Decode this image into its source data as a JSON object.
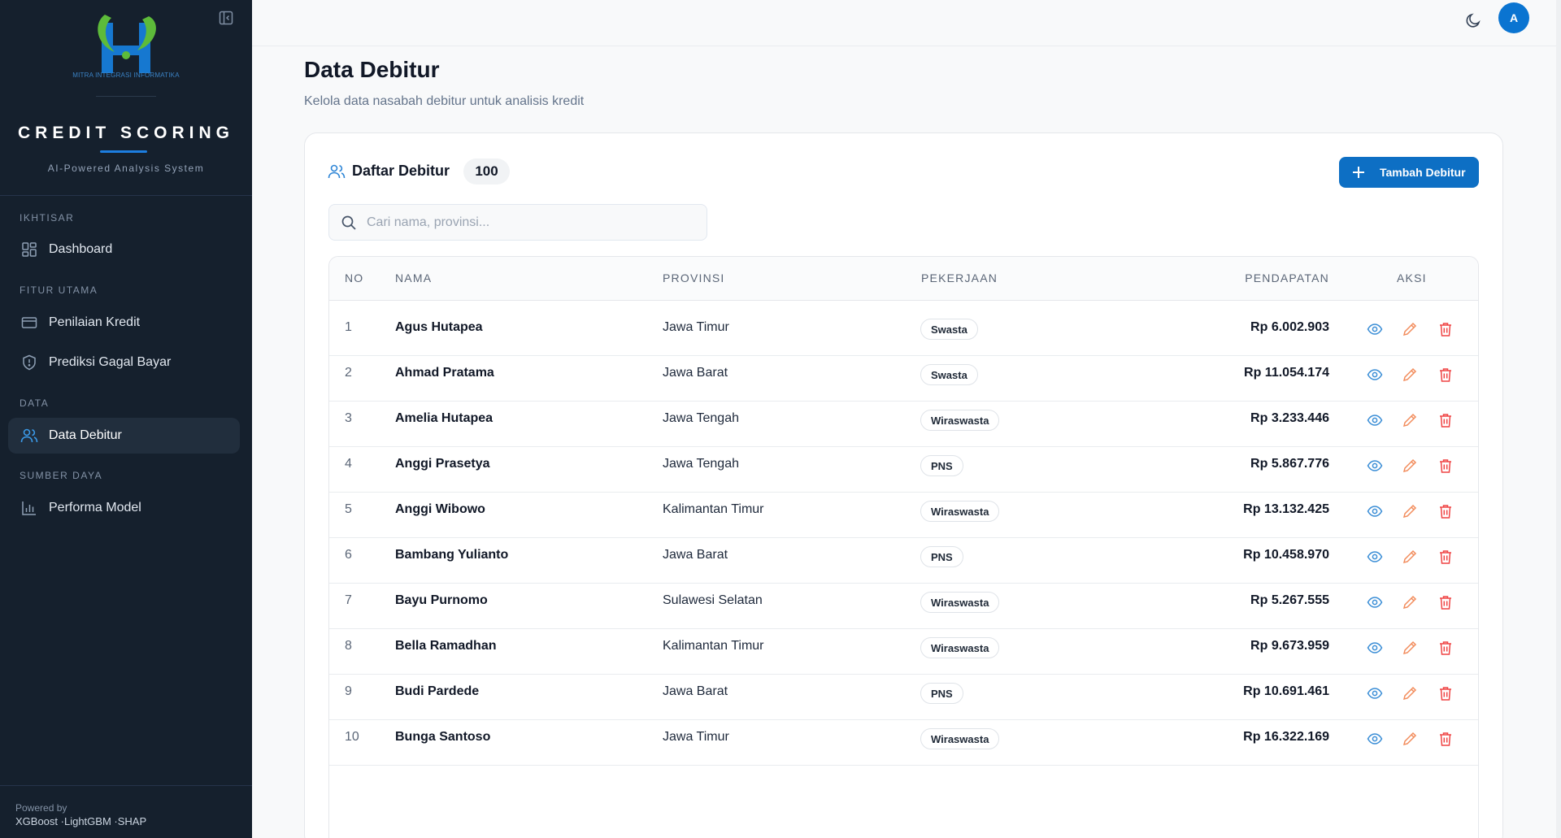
{
  "colors": {
    "sidebar_bg": "#15202d",
    "accent": "#0d6fc4",
    "edit": "#f28c5c",
    "delete": "#ef4444",
    "view": "#3b8ed6"
  },
  "sidebar": {
    "logo_tagline": "MITRA INTEGRASI INFORMATIKA",
    "brand_title": "CREDIT SCORING",
    "brand_subtitle": "AI-Powered Analysis System",
    "sections": [
      {
        "label": "IKHTISAR",
        "items": [
          {
            "label": "Dashboard",
            "icon": "dashboard-grid-icon"
          }
        ]
      },
      {
        "label": "FITUR UTAMA",
        "items": [
          {
            "label": "Penilaian Kredit",
            "icon": "credit-card-icon"
          },
          {
            "label": "Prediksi Gagal Bayar",
            "icon": "shield-icon"
          }
        ]
      },
      {
        "label": "DATA",
        "items": [
          {
            "label": "Data Debitur",
            "icon": "users-icon",
            "active": true
          }
        ]
      },
      {
        "label": "SUMBER DAYA",
        "items": [
          {
            "label": "Performa Model",
            "icon": "bar-chart-icon"
          }
        ]
      }
    ],
    "footer_powered": "Powered by",
    "footer_stack": "XGBoost ·LightGBM ·SHAP"
  },
  "topbar": {
    "avatar_initial": "A"
  },
  "page": {
    "title": "Data Debitur",
    "subtitle": "Kelola data nasabah debitur untuk analisis kredit"
  },
  "card": {
    "title": "Daftar Debitur",
    "count": "100",
    "add_button": "Tambah Debitur",
    "search_placeholder": "Cari nama, provinsi..."
  },
  "table": {
    "headers": {
      "no": "NO",
      "nama": "NAMA",
      "provinsi": "PROVINSI",
      "pekerjaan": "PEKERJAAN",
      "pendapatan": "PENDAPATAN",
      "aksi": "AKSI"
    },
    "rows": [
      {
        "no": "1",
        "nama": "Agus Hutapea",
        "provinsi": "Jawa Timur",
        "pekerjaan": "Swasta",
        "pendapatan": "Rp 6.002.903"
      },
      {
        "no": "2",
        "nama": "Ahmad Pratama",
        "provinsi": "Jawa Barat",
        "pekerjaan": "Swasta",
        "pendapatan": "Rp 11.054.174"
      },
      {
        "no": "3",
        "nama": "Amelia Hutapea",
        "provinsi": "Jawa Tengah",
        "pekerjaan": "Wiraswasta",
        "pendapatan": "Rp 3.233.446"
      },
      {
        "no": "4",
        "nama": "Anggi Prasetya",
        "provinsi": "Jawa Tengah",
        "pekerjaan": "PNS",
        "pendapatan": "Rp 5.867.776"
      },
      {
        "no": "5",
        "nama": "Anggi Wibowo",
        "provinsi": "Kalimantan Timur",
        "pekerjaan": "Wiraswasta",
        "pendapatan": "Rp 13.132.425"
      },
      {
        "no": "6",
        "nama": "Bambang Yulianto",
        "provinsi": "Jawa Barat",
        "pekerjaan": "PNS",
        "pendapatan": "Rp 10.458.970"
      },
      {
        "no": "7",
        "nama": "Bayu Purnomo",
        "provinsi": "Sulawesi Selatan",
        "pekerjaan": "Wiraswasta",
        "pendapatan": "Rp 5.267.555"
      },
      {
        "no": "8",
        "nama": "Bella Ramadhan",
        "provinsi": "Kalimantan Timur",
        "pekerjaan": "Wiraswasta",
        "pendapatan": "Rp 9.673.959"
      },
      {
        "no": "9",
        "nama": "Budi Pardede",
        "provinsi": "Jawa Barat",
        "pekerjaan": "PNS",
        "pendapatan": "Rp 10.691.461"
      },
      {
        "no": "10",
        "nama": "Bunga Santoso",
        "provinsi": "Jawa Timur",
        "pekerjaan": "Wiraswasta",
        "pendapatan": "Rp 16.322.169"
      }
    ]
  }
}
